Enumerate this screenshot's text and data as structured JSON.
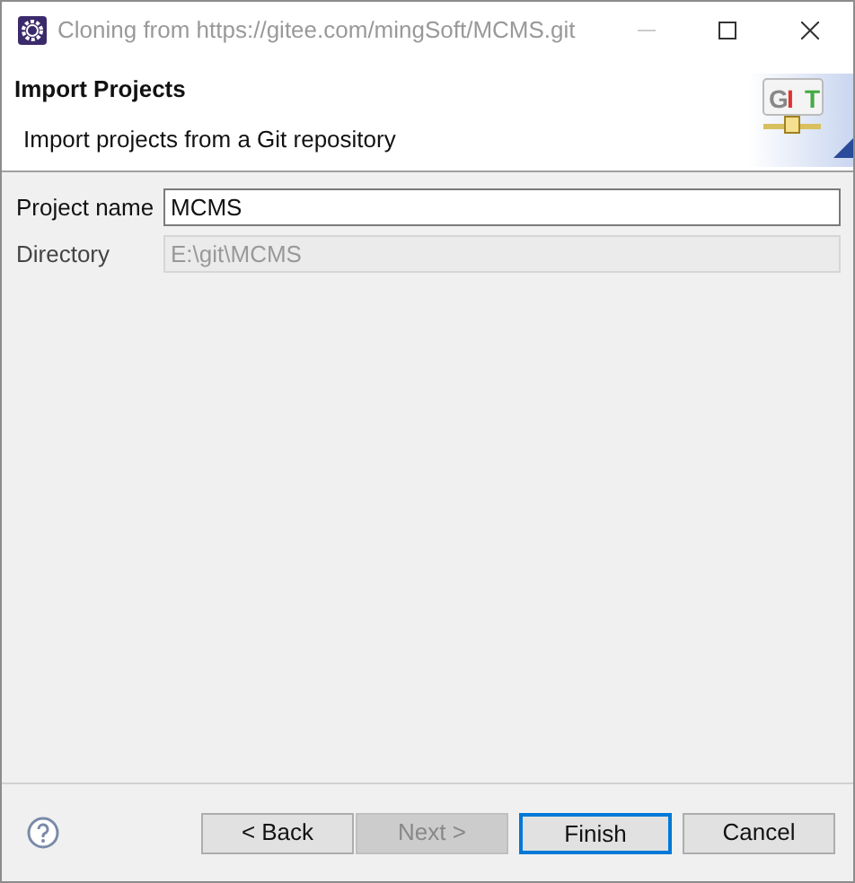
{
  "window": {
    "title": "Cloning from https://gitee.com/mingSoft/MCMS.git"
  },
  "header": {
    "title": "Import Projects",
    "description": "Import projects from a Git repository",
    "logo": [
      {
        "text": "G",
        "color": "#888888"
      },
      {
        "text": "I",
        "color": "#dd3333"
      },
      {
        "text": "T",
        "color": "#44aa44"
      }
    ]
  },
  "fields": [
    {
      "label": "Project name",
      "value": "MCMS",
      "disabled": false
    },
    {
      "label": "Directory",
      "value": "E:\\git\\MCMS",
      "disabled": true
    }
  ],
  "buttons": [
    {
      "label": "< Back",
      "disabled": false,
      "default": false
    },
    {
      "label": "Next >",
      "disabled": true,
      "default": false
    },
    {
      "label": "Finish",
      "disabled": false,
      "default": true
    },
    {
      "label": "Cancel",
      "disabled": false,
      "default": false
    }
  ]
}
